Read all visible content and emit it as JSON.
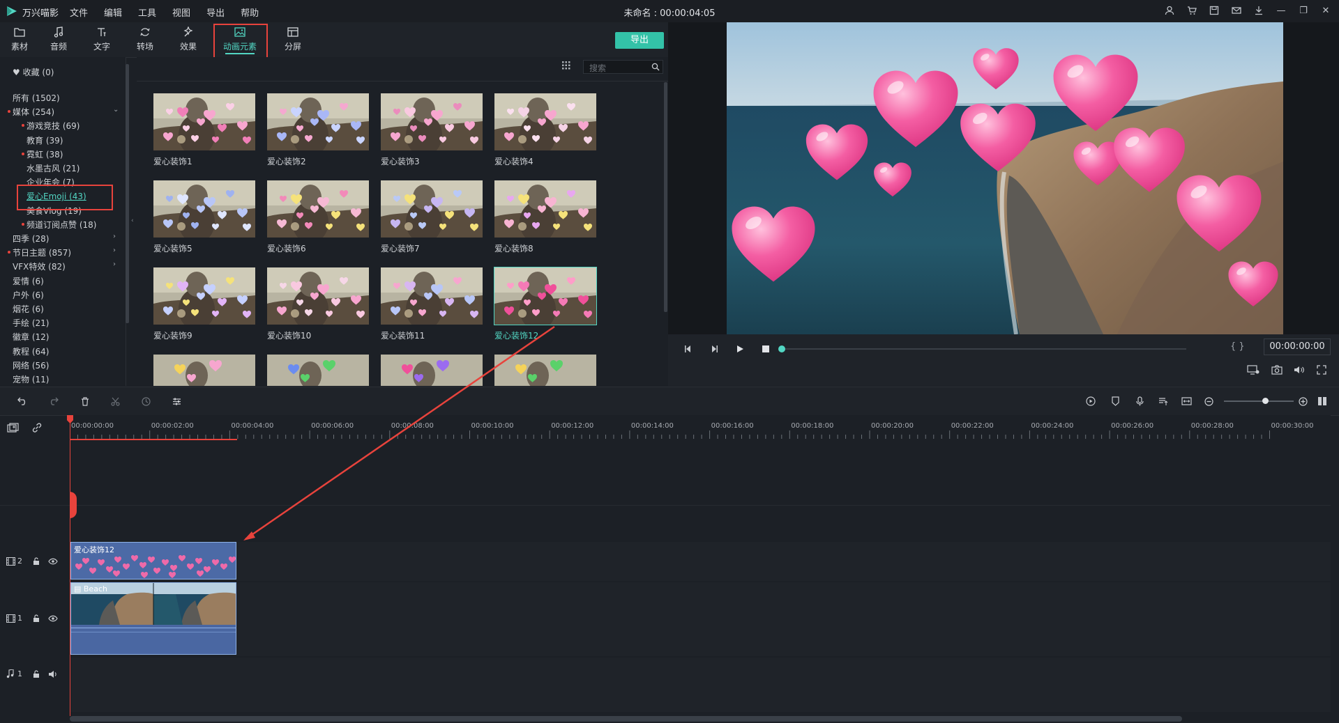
{
  "app": {
    "name": "万兴喵影",
    "document_title": "未命名 : 00:00:04:05",
    "menu": [
      "文件",
      "编辑",
      "工具",
      "视图",
      "导出",
      "帮助"
    ],
    "brand_color": "#52d6c3",
    "highlight_color": "#e8433c"
  },
  "toolbar": {
    "tabs": [
      {
        "label": "素材",
        "icon": "folder-icon"
      },
      {
        "label": "音频",
        "icon": "music-note-icon"
      },
      {
        "label": "文字",
        "icon": "text-icon"
      },
      {
        "label": "转场",
        "icon": "transition-icon"
      },
      {
        "label": "效果",
        "icon": "effects-icon"
      },
      {
        "label": "动画元素",
        "icon": "image-element-icon",
        "active": true
      },
      {
        "label": "分屏",
        "icon": "split-screen-icon"
      }
    ],
    "export_label": "导出"
  },
  "sidebar": {
    "favorites": "收藏 (0)",
    "categories": [
      {
        "label": "所有 (1502)",
        "indent": 0
      },
      {
        "label": "媒体 (254)",
        "indent": 0,
        "dot": true,
        "expanded": true
      },
      {
        "label": "游戏竞技 (69)",
        "indent": 1,
        "dot": true
      },
      {
        "label": "教育 (39)",
        "indent": 1
      },
      {
        "label": "霓虹 (38)",
        "indent": 1,
        "dot": true
      },
      {
        "label": "水墨古风 (21)",
        "indent": 1
      },
      {
        "label": "企业年会 (7)",
        "indent": 1
      },
      {
        "label": "爱心Emoji (43)",
        "indent": 1,
        "selected": true
      },
      {
        "label": "美食Vlog (19)",
        "indent": 1
      },
      {
        "label": "频道订阅点赞 (18)",
        "indent": 1,
        "dot": true
      },
      {
        "label": "四季 (28)",
        "indent": 0,
        "chevron": true
      },
      {
        "label": "节日主题 (857)",
        "indent": 0,
        "dot": true,
        "chevron": true
      },
      {
        "label": "VFX特效 (82)",
        "indent": 0,
        "chevron": true
      },
      {
        "label": "爱情 (6)",
        "indent": 0
      },
      {
        "label": "户外 (6)",
        "indent": 0
      },
      {
        "label": "烟花 (6)",
        "indent": 0
      },
      {
        "label": "手绘 (21)",
        "indent": 0
      },
      {
        "label": "徽章 (12)",
        "indent": 0
      },
      {
        "label": "教程 (64)",
        "indent": 0
      },
      {
        "label": "网络 (56)",
        "indent": 0
      },
      {
        "label": "宠物 (11)",
        "indent": 0
      }
    ]
  },
  "library": {
    "search_placeholder": "搜索",
    "items": [
      "爱心装饰1",
      "爱心装饰2",
      "爱心装饰3",
      "爱心装饰4",
      "爱心装饰5",
      "爱心装饰6",
      "爱心装饰7",
      "爱心装饰8",
      "爱心装饰9",
      "爱心装饰10",
      "爱心装饰11",
      "爱心装饰12"
    ],
    "selected_item": "爱心装饰12"
  },
  "player": {
    "timecode": "00:00:00:00",
    "bracket_label": "{ }"
  },
  "timeline": {
    "ruler_ticks": [
      "00:00:00:00",
      "00:00:02:00",
      "00:00:04:00",
      "00:00:06:00",
      "00:00:08:00",
      "00:00:10:00",
      "00:00:12:00",
      "00:00:14:00",
      "00:00:16:00",
      "00:00:18:00",
      "00:00:20:00",
      "00:00:22:00",
      "00:00:24:00",
      "00:00:26:00",
      "00:00:28:00",
      "00:00:30:00"
    ],
    "tracks": [
      {
        "id": "2",
        "type": "video",
        "clip_label": "爱心装饰12"
      },
      {
        "id": "1",
        "type": "video",
        "clip_label": "Beach"
      },
      {
        "id": "1",
        "type": "audio"
      }
    ]
  }
}
